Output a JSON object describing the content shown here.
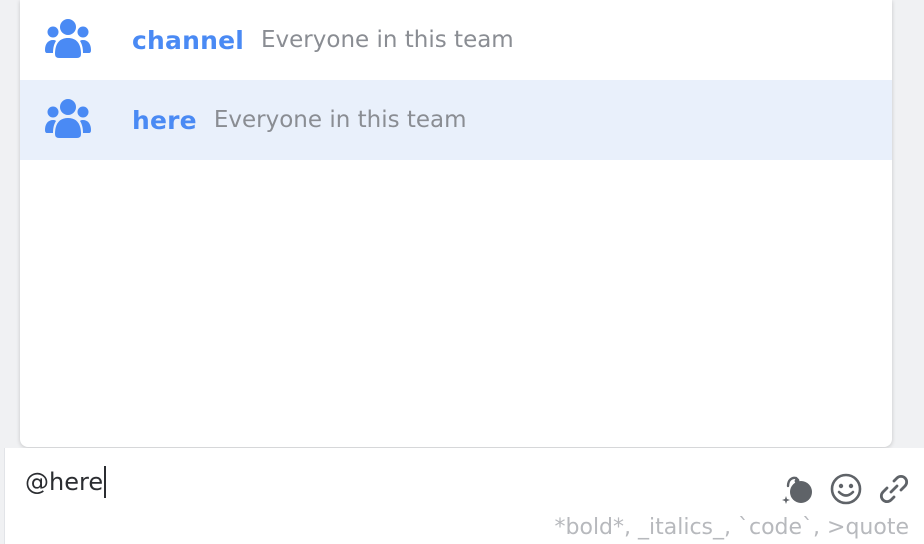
{
  "colors": {
    "accent": "#4a8af4",
    "selected_bg": "#e9f0fb",
    "muted_text": "#8a8d93",
    "icon_gray": "#5f6368"
  },
  "suggestions": {
    "items": [
      {
        "icon": "team-icon",
        "name": "channel",
        "description": "Everyone in this team",
        "selected": false
      },
      {
        "icon": "team-icon",
        "name": "here",
        "description": "Everyone in this team",
        "selected": true
      }
    ]
  },
  "composer": {
    "value": "@here",
    "format_hint": "*bold*, _italics_, `code`, >quote",
    "icons": [
      "bot-icon",
      "emoji-icon",
      "attachment-icon"
    ]
  }
}
